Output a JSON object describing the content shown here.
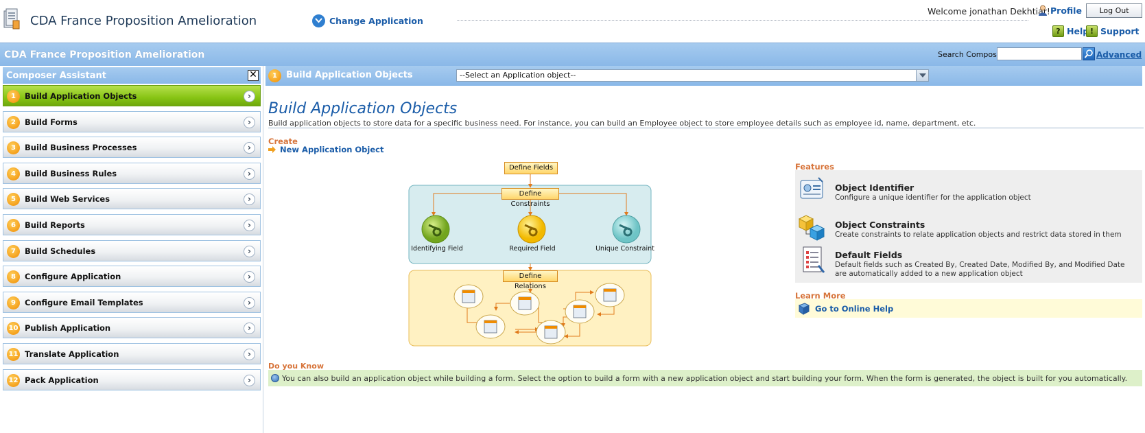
{
  "header": {
    "app_title": "CDA France Proposition Amelioration",
    "change_application": "Change Application",
    "welcome": "Welcome jonathan Dekhtiar!",
    "profile": "Profile",
    "logout": "Log Out",
    "help": "Help",
    "support": "Support",
    "help_icon_glyph": "?",
    "support_icon_glyph": "!"
  },
  "titlebar": {
    "title": "CDA France Proposition Amelioration",
    "search_label": "Search Composer",
    "search_value": "",
    "advanced": "Advanced"
  },
  "sidebar": {
    "title": "Composer Assistant",
    "close": "✕",
    "arrow_glyph": "›",
    "items": [
      {
        "num": "1",
        "label": "Build Application Objects",
        "active": true
      },
      {
        "num": "2",
        "label": "Build Forms"
      },
      {
        "num": "3",
        "label": "Build Business Processes"
      },
      {
        "num": "4",
        "label": "Build Business Rules"
      },
      {
        "num": "5",
        "label": "Build Web Services"
      },
      {
        "num": "6",
        "label": "Build Reports"
      },
      {
        "num": "7",
        "label": "Build Schedules"
      },
      {
        "num": "8",
        "label": "Configure Application"
      },
      {
        "num": "9",
        "label": "Configure Email Templates"
      },
      {
        "num": "10",
        "label": "Publish Application"
      },
      {
        "num": "11",
        "label": "Translate Application"
      },
      {
        "num": "12",
        "label": "Pack Application"
      }
    ]
  },
  "main": {
    "step_num": "1",
    "step_title": "Build Application Objects",
    "select_value": "--Select an Application object--",
    "heading": "Build Application Objects",
    "description": "Build application objects to store data for a specific business need. For instance, you can build an Employee object to store employee details such as employee id, name, department, etc.",
    "create_label": "Create",
    "new_object": "New Application Object"
  },
  "diagram": {
    "define_fields": "Define Fields",
    "define_constraints": "Define Constraints",
    "define_relations": "Define Relations",
    "identifying_field": "Identifying Field",
    "required_field": "Required Field",
    "unique_constraint": "Unique Constraint"
  },
  "features": {
    "title": "Features",
    "items": [
      {
        "title": "Object Identifier",
        "desc": "Configure a unique identifier for the application object"
      },
      {
        "title": "Object Constraints",
        "desc": "Create constraints to relate application objects and restrict data stored in them"
      },
      {
        "title": "Default Fields",
        "desc": "Default fields such as Created By, Created Date, Modified By, and Modified Date are automatically added to a new application object"
      }
    ]
  },
  "learn_more": {
    "title": "Learn More",
    "link": "Go to Online Help"
  },
  "do_you_know": {
    "title": "Do you Know",
    "text": "You can also build an application object while building a form. Select the option to build a form with a new application object and start building your form. When the form is generated, the object is built for you automatically."
  },
  "colors": {
    "header_blue": "#8ab8e8",
    "active_green": "#87c414",
    "link_blue": "#1a5ca8",
    "section_orange": "#d7743a",
    "step_orange": "#f08c00"
  }
}
